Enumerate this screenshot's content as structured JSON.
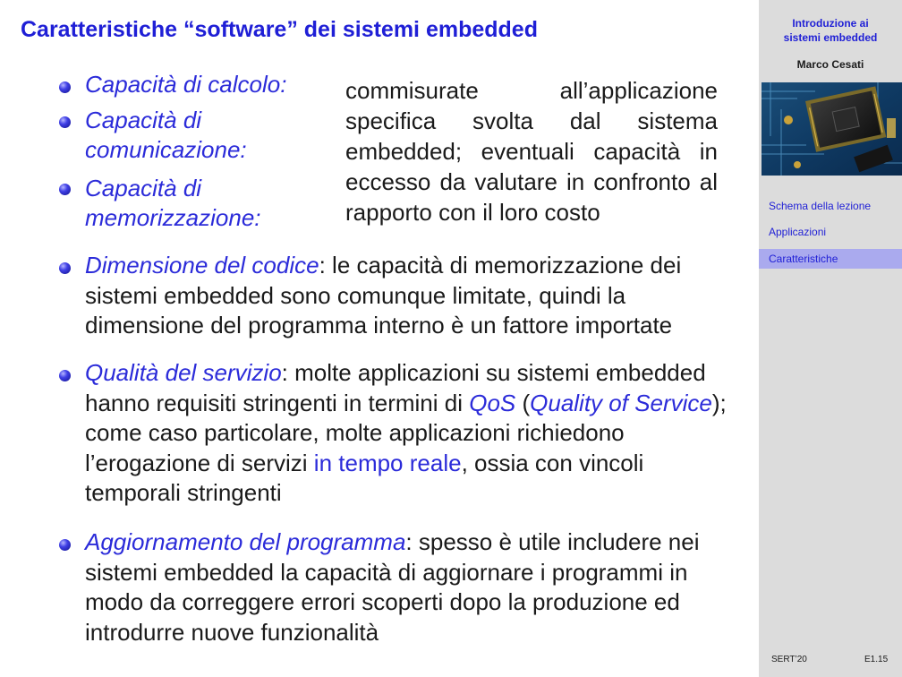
{
  "slide": {
    "title": "Caratteristiche “software” dei sistemi embedded",
    "capabilities": {
      "labels": [
        "Capacità di calcolo:",
        "Capacità di",
        "comunicazione:",
        "Capacità di",
        "memorizzazione:"
      ],
      "description": "commisurate all’applicazione specifica svolta dal sistema embedded; eventuali capacità in eccesso da valutare in confronto al rapporto con il loro costo"
    },
    "code_size": {
      "term": "Dimensione del codice",
      "text": ": le capacità di memorizzazione dei sistemi embedded sono comunque limitate, quindi la dimensione del programma interno è un fattore importate"
    },
    "qos": {
      "term": "Qualità del servizio",
      "text_a": ": molte applicazioni su sistemi embedded hanno requisiti stringenti in termini di ",
      "abbr": "QoS",
      "paren_open": " (",
      "expansion": "Quality of Service",
      "text_b": "); come caso particolare, molte applicazioni richiedono l’erogazione di servizi ",
      "realtime": "in tempo reale",
      "text_c": ", ossia con vincoli temporali stringenti"
    },
    "update": {
      "term": "Aggiornamento del programma",
      "text": ": spesso è utile includere nei sistemi embedded la capacità di aggiornare i programmi in modo da correggere errori scoperti dopo la produzione ed introdurre nuove funzionalità"
    }
  },
  "sidebar": {
    "lecture_title": "Introduzione ai sistemi embedded",
    "author": "Marco Cesati",
    "nav": [
      "Schema della lezione",
      "Applicazioni",
      "Caratteristiche"
    ],
    "active_index": 2,
    "footer_left": "SERT’20",
    "footer_right": "E1.15"
  }
}
